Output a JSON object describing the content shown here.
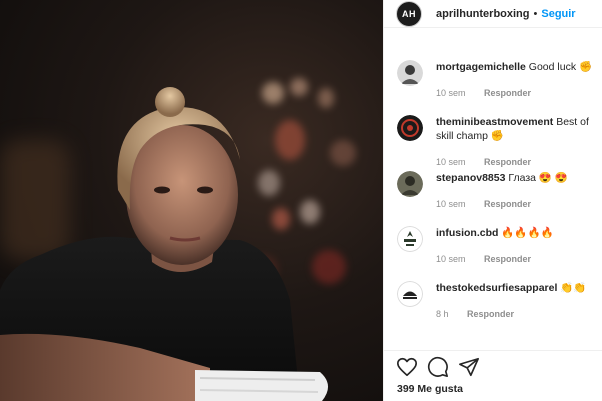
{
  "post": {
    "author": "aprilhunterboxing",
    "author_avatar_initials": "AH",
    "separator": "•",
    "follow_label": "Seguir",
    "likes": "399 Me gusta"
  },
  "comments": [
    {
      "user": "mortgagemichelle",
      "text": "Good luck ✊",
      "age": "10 sem",
      "reply": "Responder"
    },
    {
      "user": "theminibeastmovement",
      "text": "Best of skill champ ✊",
      "age": "10 sem",
      "reply": "Responder"
    },
    {
      "user": "stepanov8853",
      "text": "Глаза 😍 😍",
      "age": "10 sem",
      "reply": "Responder"
    },
    {
      "user": "infusion.cbd",
      "text": "🔥🔥🔥🔥",
      "age": "10 sem",
      "reply": "Responder"
    },
    {
      "user": "thestokedsurfiesapparel",
      "text": "👏👏",
      "age": "8 h",
      "reply": "Responder"
    }
  ],
  "icons": {
    "like": "heart-icon",
    "comment": "comment-icon",
    "share": "share-icon"
  },
  "colors": {
    "link": "#0095f6",
    "meta": "#8e8e8e",
    "text": "#262626"
  }
}
